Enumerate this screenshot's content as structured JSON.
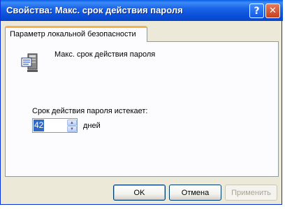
{
  "window": {
    "title": "Свойства: Макс. срок действия пароля",
    "help_glyph": "?",
    "close_glyph": "✕"
  },
  "tab": {
    "label": "Параметр локальной безопасности"
  },
  "policy": {
    "icon": "policy-server-icon",
    "name": "Макс. срок действия пароля"
  },
  "setting": {
    "label": "Срок действия пароля истекает:",
    "value": "42",
    "unit": "дней"
  },
  "buttons": {
    "ok": "OK",
    "cancel": "Отмена",
    "apply": "Применить"
  }
}
